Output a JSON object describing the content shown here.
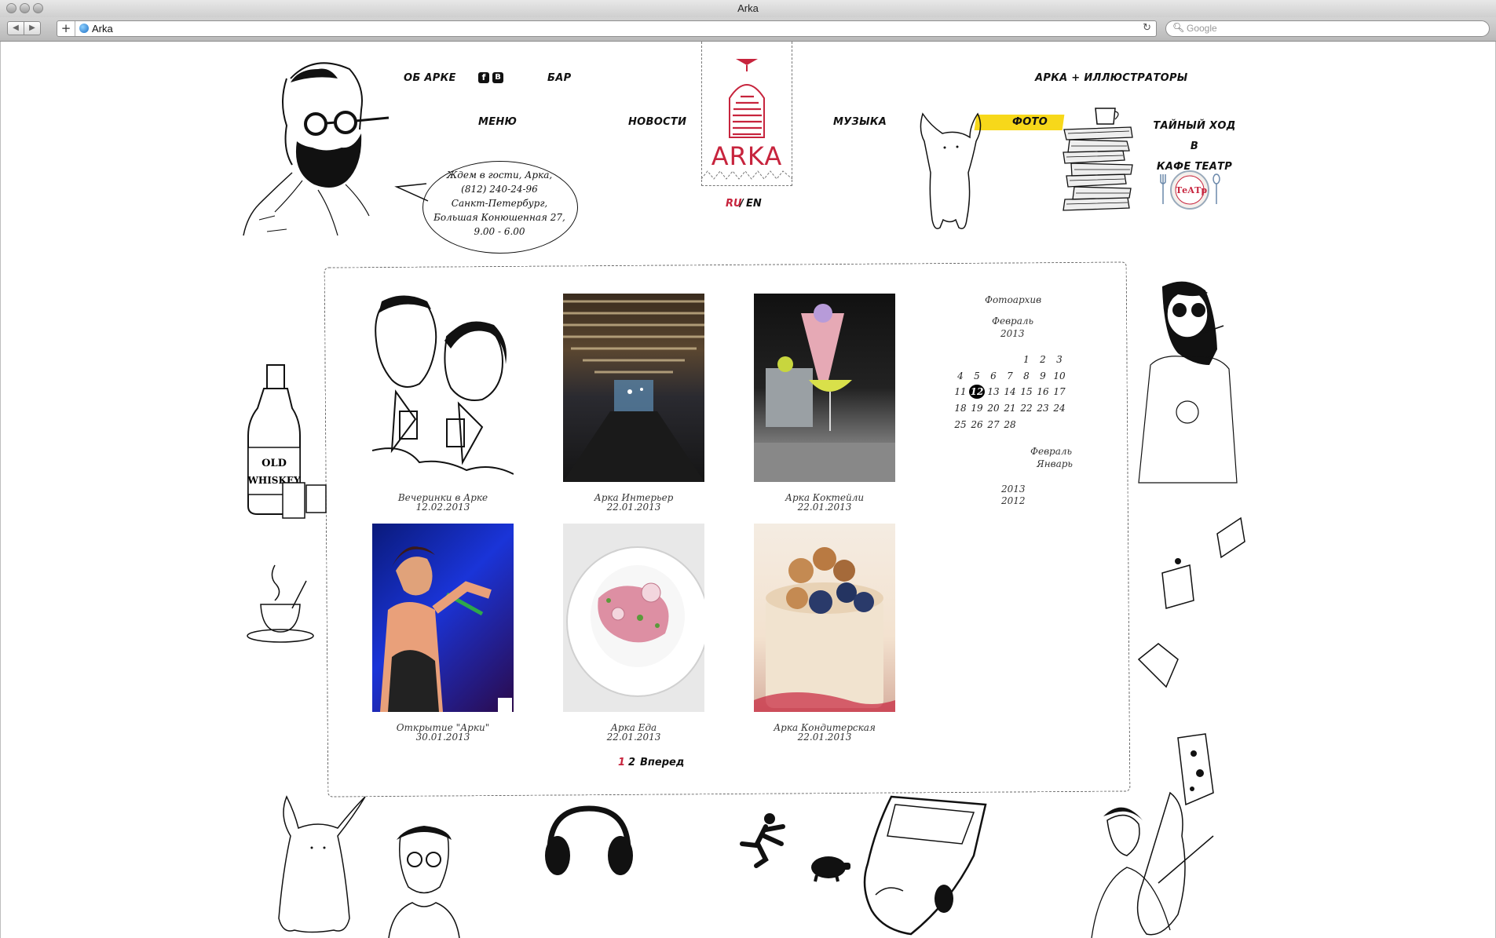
{
  "browser": {
    "window_title": "Arka",
    "url": "Arka",
    "search_placeholder": "Google"
  },
  "nav": {
    "about": "ОБ АРКЕ",
    "bar": "БАР",
    "menu": "МЕНЮ",
    "news": "НОВОСТИ",
    "music": "МУЗЫКА",
    "illustrators": "АРКА + ИЛЛЮСТРАТОРЫ",
    "photo": "ФОТО",
    "secret_line1": "ТАЙНЫЙ ХОД В",
    "secret_line2": "КАФЕ ТЕАТР"
  },
  "social": {
    "facebook": "f",
    "vkontakte": "B"
  },
  "logo": {
    "text": "ARKA"
  },
  "lang": {
    "ru": "RU",
    "sep": "/",
    "en": "EN"
  },
  "bubble": {
    "lines": [
      "Ждем в гости, Арка,",
      "(812) 240-24-96",
      "Санкт-Петербург,",
      "Большая Конюшенная 27,",
      "9.00 - 6.00"
    ]
  },
  "cafe_theatre_badge": "ТеАТр",
  "gallery": [
    {
      "title": "Вечеринки в Арке",
      "date": "12.02.2013"
    },
    {
      "title": "Арка Интерьер",
      "date": "22.01.2013"
    },
    {
      "title": "Арка Коктейли",
      "date": "22.01.2013"
    },
    {
      "title": "Открытие \"Арки\"",
      "date": "30.01.2013"
    },
    {
      "title": "Арка Еда",
      "date": "22.01.2013"
    },
    {
      "title": "Арка Кондитерская",
      "date": "22.01.2013"
    }
  ],
  "archive": {
    "heading": "Фотоархив",
    "month": "Февраль",
    "year": "2013",
    "days": [
      [
        "",
        "",
        "",
        "",
        "1",
        "2",
        "3"
      ],
      [
        "4",
        "5",
        "6",
        "7",
        "8",
        "9",
        "10"
      ],
      [
        "11",
        "12",
        "13",
        "14",
        "15",
        "16",
        "17"
      ],
      [
        "18",
        "19",
        "20",
        "21",
        "22",
        "23",
        "24"
      ],
      [
        "25",
        "26",
        "27",
        "28",
        "",
        "",
        ""
      ]
    ],
    "selected_day": "12",
    "months_list": [
      "Февраль",
      "Январь"
    ],
    "years_list": [
      "2013",
      "2012"
    ]
  },
  "pagination": {
    "current": "1",
    "next_page": "2",
    "forward": "Вперед"
  },
  "colors": {
    "accent_red": "#c7243d",
    "highlight_yellow": "#f7d81a",
    "selected_day_bg": "#000000"
  }
}
